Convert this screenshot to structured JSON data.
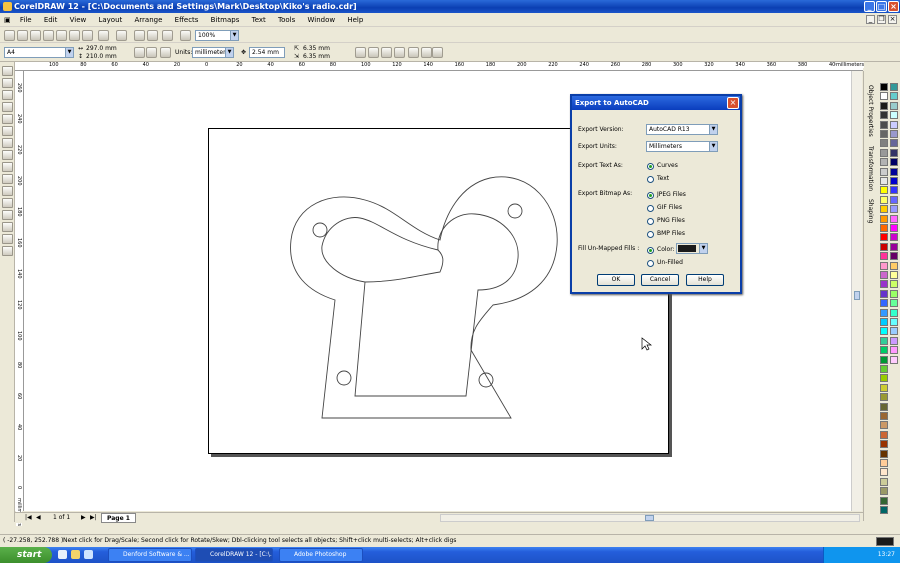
{
  "window": {
    "title": "CorelDRAW 12 - [C:\\Documents and Settings\\Mark\\Desktop\\Kiko's radio.cdr]",
    "minimize": "_",
    "maximize": "□",
    "close": "×"
  },
  "menu": [
    "File",
    "Edit",
    "View",
    "Layout",
    "Arrange",
    "Effects",
    "Bitmaps",
    "Text",
    "Tools",
    "Window",
    "Help"
  ],
  "toolbar": {
    "zoom": "100%"
  },
  "propertybar": {
    "paper": "A4",
    "width": "297.0 mm",
    "height": "210.0 mm",
    "units_label": "Units:",
    "units": "millimeters",
    "nudge": "2.54 mm",
    "dup_x": "6.35 mm",
    "dup_y": "6.35 mm"
  },
  "ruler": {
    "h_labels": [
      "100",
      "80",
      "60",
      "40",
      "20",
      "0",
      "20",
      "40",
      "60",
      "80",
      "100",
      "120",
      "140",
      "160",
      "180",
      "200",
      "220",
      "240",
      "260",
      "280",
      "300",
      "320",
      "340",
      "360",
      "380",
      "400"
    ],
    "h_unit": "millimeters",
    "v_labels": [
      "260",
      "240",
      "220",
      "200",
      "180",
      "160",
      "140",
      "120",
      "100",
      "80",
      "60",
      "40",
      "20",
      "0",
      "-20"
    ],
    "v_unit": "millimeters"
  },
  "docker": {
    "tabs": [
      "Object Properties",
      "Transformation",
      "Shaping"
    ]
  },
  "pagenav": {
    "count": "1 of 1",
    "tab": "Page 1"
  },
  "status": {
    "coords": "( -27.258, 252.788 )",
    "hint": "Next click for Drag/Scale; Second click for Rotate/Skew; Dbl-clicking tool selects all objects; Shift+click multi-selects; Alt+click digs"
  },
  "taskbar": {
    "start": "start",
    "tasks": [
      "Denford Software & ...",
      "CorelDRAW 12 - [C:\\...",
      "Adobe Photoshop"
    ],
    "time": "13:27"
  },
  "dialog": {
    "title": "Export to AutoCAD",
    "export_version_label": "Export Version:",
    "export_version": "AutoCAD R13",
    "export_units_label": "Export Units:",
    "export_units": "Millimeters",
    "text_as_label": "Export Text As:",
    "text_options": [
      "Curves",
      "Text"
    ],
    "bitmap_as_label": "Export Bitmap As:",
    "bitmap_options": [
      "JPEG Files",
      "GIF Files",
      "PNG Files",
      "BMP Files"
    ],
    "fill_label": "Fill Un-Mapped Fills :",
    "fill_options": [
      "Color:",
      "Un-Filled"
    ],
    "fill_color": "#1a1a1a",
    "ok": "OK",
    "cancel": "Cancel",
    "help": "Help"
  },
  "palette": [
    "#000000",
    "#ffffff",
    "#1a1a1a",
    "#333333",
    "#4d4d4d",
    "#666666",
    "#808080",
    "#999999",
    "#b3b3b3",
    "#cccccc",
    "#e6e6e6",
    "#ffff00",
    "#ffff66",
    "#ffcc00",
    "#ff9900",
    "#ff6600",
    "#ff0000",
    "#cc0000",
    "#ff3399",
    "#ff99cc",
    "#cc66cc",
    "#9933cc",
    "#6633cc",
    "#3366ff",
    "#3399ff",
    "#00ccff",
    "#00ffff",
    "#33cc99",
    "#00cc66",
    "#009933",
    "#66cc33",
    "#99cc00",
    "#cccc33",
    "#999933",
    "#666633",
    "#996633",
    "#cc9966",
    "#cc6633",
    "#993300",
    "#663300",
    "#ffcc99",
    "#ffe6cc",
    "#cccc99",
    "#999966",
    "#336633",
    "#006666",
    "#339999",
    "#66cccc",
    "#99cccc",
    "#ccffff",
    "#ccccff",
    "#9999cc",
    "#666699",
    "#333366",
    "#000066",
    "#000099",
    "#0000cc",
    "#3333ff",
    "#6666ff",
    "#9999ff",
    "#ff66ff",
    "#ff00ff",
    "#cc00cc",
    "#990099",
    "#660066",
    "#ffcc66",
    "#ffff99",
    "#ccff66",
    "#99ff66",
    "#66ff99",
    "#33ffcc",
    "#66ffff",
    "#99ccff",
    "#cc99ff",
    "#ff99ff",
    "#ffccff"
  ]
}
